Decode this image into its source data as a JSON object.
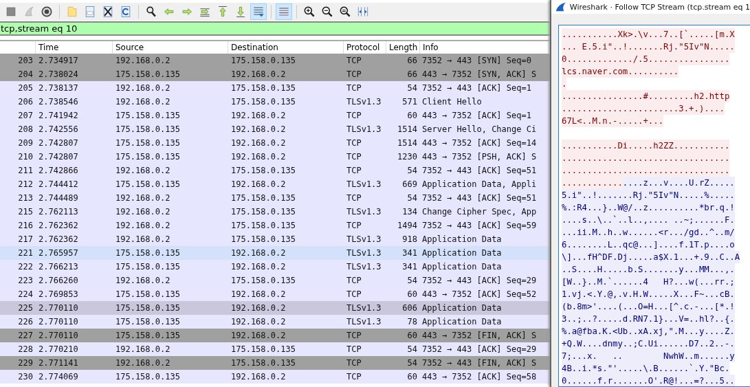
{
  "toolbar": [
    {
      "kind": "stop",
      "pressed": false
    },
    {
      "kind": "fin",
      "pressed": false
    },
    {
      "kind": "gear",
      "pressed": false
    },
    {
      "kind": "sep"
    },
    {
      "kind": "folder",
      "pressed": false
    },
    {
      "kind": "file",
      "pressed": false
    },
    {
      "kind": "close",
      "pressed": false
    },
    {
      "kind": "reload",
      "pressed": false
    },
    {
      "kind": "sep"
    },
    {
      "kind": "find",
      "pressed": false
    },
    {
      "kind": "back",
      "pressed": false
    },
    {
      "kind": "forward",
      "pressed": false
    },
    {
      "kind": "goto",
      "pressed": false
    },
    {
      "kind": "first",
      "pressed": false
    },
    {
      "kind": "last",
      "pressed": false
    },
    {
      "kind": "autoscroll",
      "pressed": true
    },
    {
      "kind": "sep"
    },
    {
      "kind": "colorize",
      "pressed": true
    },
    {
      "kind": "sep"
    },
    {
      "kind": "zoomin",
      "pressed": false
    },
    {
      "kind": "zoomout",
      "pressed": false
    },
    {
      "kind": "zoomreset",
      "pressed": false
    },
    {
      "kind": "resize",
      "pressed": false
    }
  ],
  "filter": {
    "value": "tcp,stream eq 10"
  },
  "table": {
    "columns": [
      "Time",
      "Source",
      "Destination",
      "Protocol",
      "Length",
      "Info"
    ],
    "rows": [
      {
        "no": "203",
        "time": "2.734917",
        "source": "192.168.0.2",
        "destination": "175.158.0.135",
        "protocol": "TCP",
        "length": "66",
        "info": "7352 → 443 [SYN] Seq=0",
        "color": "#a0a0a0"
      },
      {
        "no": "204",
        "time": "2.738024",
        "source": "175.158.0.135",
        "destination": "192.168.0.2",
        "protocol": "TCP",
        "length": "66",
        "info": "443 → 7352 [SYN, ACK] S",
        "color": "#a0a0a0"
      },
      {
        "no": "205",
        "time": "2.738137",
        "source": "192.168.0.2",
        "destination": "175.158.0.135",
        "protocol": "TCP",
        "length": "54",
        "info": "7352 → 443 [ACK] Seq=1",
        "color": "#e7e6ff"
      },
      {
        "no": "206",
        "time": "2.738546",
        "source": "192.168.0.2",
        "destination": "175.158.0.135",
        "protocol": "TLSv1.3",
        "length": "571",
        "info": "Client Hello",
        "color": "#e7e6ff"
      },
      {
        "no": "207",
        "time": "2.741942",
        "source": "175.158.0.135",
        "destination": "192.168.0.2",
        "protocol": "TCP",
        "length": "60",
        "info": "443 → 7352 [ACK] Seq=1",
        "color": "#e7e6ff"
      },
      {
        "no": "208",
        "time": "2.742556",
        "source": "175.158.0.135",
        "destination": "192.168.0.2",
        "protocol": "TLSv1.3",
        "length": "1514",
        "info": "Server Hello, Change Ci",
        "color": "#e7e6ff"
      },
      {
        "no": "209",
        "time": "2.742807",
        "source": "175.158.0.135",
        "destination": "192.168.0.2",
        "protocol": "TCP",
        "length": "1514",
        "info": "443 → 7352 [ACK] Seq=14",
        "color": "#e7e6ff"
      },
      {
        "no": "210",
        "time": "2.742807",
        "source": "175.158.0.135",
        "destination": "192.168.0.2",
        "protocol": "TCP",
        "length": "1230",
        "info": "443 → 7352 [PSH, ACK] S",
        "color": "#e7e6ff"
      },
      {
        "no": "211",
        "time": "2.742866",
        "source": "192.168.0.2",
        "destination": "175.158.0.135",
        "protocol": "TCP",
        "length": "54",
        "info": "7352 → 443 [ACK] Seq=51",
        "color": "#e7e6ff"
      },
      {
        "no": "212",
        "time": "2.744412",
        "source": "175.158.0.135",
        "destination": "192.168.0.2",
        "protocol": "TLSv1.3",
        "length": "669",
        "info": "Application Data, Appli",
        "color": "#e7e6ff"
      },
      {
        "no": "213",
        "time": "2.744489",
        "source": "192.168.0.2",
        "destination": "175.158.0.135",
        "protocol": "TCP",
        "length": "54",
        "info": "7352 → 443 [ACK] Seq=51",
        "color": "#e7e6ff"
      },
      {
        "no": "215",
        "time": "2.762113",
        "source": "192.168.0.2",
        "destination": "175.158.0.135",
        "protocol": "TLSv1.3",
        "length": "134",
        "info": "Change Cipher Spec, App",
        "color": "#e7e6ff"
      },
      {
        "no": "216",
        "time": "2.762362",
        "source": "192.168.0.2",
        "destination": "175.158.0.135",
        "protocol": "TCP",
        "length": "1494",
        "info": "7352 → 443 [ACK] Seq=59",
        "color": "#e7e6ff"
      },
      {
        "no": "217",
        "time": "2.762362",
        "source": "192.168.0.2",
        "destination": "175.158.0.135",
        "protocol": "TLSv1.3",
        "length": "918",
        "info": "Application Data",
        "color": "#e7e6ff"
      },
      {
        "no": "221",
        "time": "2.765957",
        "source": "175.158.0.135",
        "destination": "192.168.0.2",
        "protocol": "TLSv1.3",
        "length": "341",
        "info": "Application Data",
        "color": "#d3e2fa"
      },
      {
        "no": "222",
        "time": "2.766213",
        "source": "175.158.0.135",
        "destination": "192.168.0.2",
        "protocol": "TLSv1.3",
        "length": "341",
        "info": "Application Data",
        "color": "#e7e6ff"
      },
      {
        "no": "223",
        "time": "2.766260",
        "source": "192.168.0.2",
        "destination": "175.158.0.135",
        "protocol": "TCP",
        "length": "54",
        "info": "7352 → 443 [ACK] Seq=29",
        "color": "#e7e6ff"
      },
      {
        "no": "224",
        "time": "2.769853",
        "source": "175.158.0.135",
        "destination": "192.168.0.2",
        "protocol": "TCP",
        "length": "60",
        "info": "443 → 7352 [ACK] Seq=52",
        "color": "#e7e6ff"
      },
      {
        "no": "225",
        "time": "2.770110",
        "source": "175.158.0.135",
        "destination": "192.168.0.2",
        "protocol": "TLSv1.3",
        "length": "606",
        "info": "Application Data",
        "color": "#c8c7dc"
      },
      {
        "no": "226",
        "time": "2.770110",
        "source": "175.158.0.135",
        "destination": "192.168.0.2",
        "protocol": "TLSv1.3",
        "length": "78",
        "info": "Application Data",
        "color": "#e7e6ff"
      },
      {
        "no": "227",
        "time": "2.770110",
        "source": "175.158.0.135",
        "destination": "192.168.0.2",
        "protocol": "TCP",
        "length": "60",
        "info": "443 → 7352 [FIN, ACK] S",
        "color": "#a0a0a0"
      },
      {
        "no": "228",
        "time": "2.770210",
        "source": "192.168.0.2",
        "destination": "175.158.0.135",
        "protocol": "TCP",
        "length": "54",
        "info": "7352 → 443 [ACK] Seq=29",
        "color": "#e7e6ff"
      },
      {
        "no": "229",
        "time": "2.771141",
        "source": "192.168.0.2",
        "destination": "175.158.0.135",
        "protocol": "TCP",
        "length": "54",
        "info": "7352 → 443 [FIN, ACK] S",
        "color": "#a0a0a0"
      },
      {
        "no": "230",
        "time": "2.774069",
        "source": "175.158.0.135",
        "destination": "192.168.0.2",
        "protocol": "TCP",
        "length": "60",
        "info": "443 → 7352 [ACK] Seq=58",
        "color": "#e7e6ff"
      }
    ]
  },
  "follow_window": {
    "title": "Wireshark · Follow TCP Stream (tcp.stream eq 1",
    "blocks": [
      [
        [
          {
            "kind": "client",
            "text": "...........Xk>.\\v...7..[`.....[m.X"
          }
        ],
        [
          {
            "kind": "client",
            "text": "... E.5.i\"..!.......Rj.\"5Iv\"N....."
          }
        ],
        [
          {
            "kind": "client",
            "text": "0............./.5................"
          }
        ],
        [
          {
            "kind": "client",
            "text": "lcs.naver.com.........."
          }
        ],
        [
          {
            "kind": "client",
            "text": "."
          }
        ],
        [
          {
            "kind": "client",
            "text": "................#.........h2.http"
          }
        ],
        [
          {
            "kind": "client",
            "text": ".......................3.+.)...."
          }
        ],
        [
          {
            "kind": "client",
            "text": "67L<..M.n.-.....+..."
          }
        ]
      ],
      [
        [
          {
            "kind": "client",
            "text": "...........Di.....h2ZZ..........."
          }
        ],
        [
          {
            "kind": "client",
            "text": "................................."
          }
        ],
        [
          {
            "kind": "client",
            "text": "................................."
          }
        ],
        [
          {
            "kind": "client",
            "text": "............"
          },
          {
            "kind": "server",
            "text": "....z...v....U.rZ....."
          }
        ],
        [
          {
            "kind": "server",
            "text": "5.i\"..!.......Rj.\"5Iv\"N.....%....."
          }
        ],
        [
          {
            "kind": "server",
            "text": "%.:R4...}..W@/..z..........*br.q.!"
          }
        ],
        [
          {
            "kind": "server",
            "text": "....s..\\..`..l..,.... ..~;......F."
          }
        ],
        [
          {
            "kind": "server",
            "text": "...ii.M..h..w......<r.../gd..^..m/"
          }
        ],
        [
          {
            "kind": "server",
            "text": "6........L..qc@...]....f.1T.p....o"
          }
        ],
        [
          {
            "kind": "server",
            "text": "\\]...fH^DF.Dj.....a$X.1...+.9..C..A"
          }
        ],
        [
          {
            "kind": "server",
            "text": "..S....H.....b.S.......y...MM...,."
          }
        ],
        [
          {
            "kind": "server",
            "text": "[W..}..M.`......4   H?...w(...rr.;"
          }
        ],
        [
          {
            "kind": "server",
            "text": "1.vj.<.Y.@,.v.H.W.....X...F~...cB."
          }
        ],
        [
          {
            "kind": "server",
            "text": "(b.8m>'....(...O=H...[^.c.-...[*.!"
          }
        ],
        [
          {
            "kind": "server",
            "text": "3..;..?.....d.RN7.1}...V=..hl?..{."
          }
        ],
        [
          {
            "kind": "server",
            "text": "%.a@fba.K.<Ub..xA.xj,\".M...y....Z."
          }
        ],
        [
          {
            "kind": "server",
            "text": "+Q.W....dnmy..;C.Ui......D7..2..-."
          }
        ],
        [
          {
            "kind": "server",
            "text": "7;...x.   ..        NwhW..m......y"
          }
        ],
        [
          {
            "kind": "server",
            "text": "4B..i.*s.\"'.....\\.B......`.Y.\"Bc."
          }
        ],
        [
          {
            "kind": "server",
            "text": "0......f.r.......O'.R@!...=?...5.."
          }
        ]
      ]
    ]
  }
}
